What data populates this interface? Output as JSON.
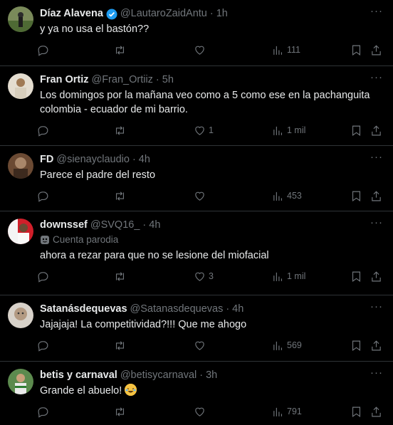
{
  "tweets": [
    {
      "name": "Díaz Alavena",
      "verified": true,
      "handle": "@LautaroZaidAntu",
      "dot": "·",
      "time": "1h",
      "parody": "",
      "text": "y ya no usa el bastón??",
      "likes": "",
      "views": "111",
      "avatar_color": "#6b7a4c"
    },
    {
      "name": "Fran Ortiz",
      "verified": false,
      "handle": "@Fran_Ortiiz",
      "dot": "·",
      "time": "5h",
      "parody": "",
      "text": "Los domingos por la mañana veo como a 5 como ese en la pachanguita colombia - ecuador de mi barrio.",
      "likes": "1",
      "views": "1 mil",
      "avatar_color": "#c9b99a"
    },
    {
      "name": "FD",
      "verified": false,
      "handle": "@sienayclaudio",
      "dot": "·",
      "time": "4h",
      "parody": "",
      "text": "Parece el padre del resto",
      "likes": "",
      "views": "453",
      "avatar_color": "#8a5a3c"
    },
    {
      "name": "downssef",
      "verified": false,
      "handle": "@SVQ16_",
      "dot": "·",
      "time": "4h",
      "parody": "Cuenta parodia",
      "text": "ahora a rezar para que no se lesione del miofacial",
      "likes": "3",
      "views": "1 mil",
      "avatar_color": "#d01f2a"
    },
    {
      "name": "Satanásdequevas",
      "verified": false,
      "handle": "@Satanasdequevas",
      "dot": "·",
      "time": "4h",
      "parody": "",
      "text": "Jajajaja! La competitividad?!!! Que me ahogo",
      "likes": "",
      "views": "569",
      "avatar_color": "#b7a89a"
    },
    {
      "name": "betis y carnaval",
      "verified": false,
      "handle": "@betisycarnaval",
      "dot": "·",
      "time": "3h",
      "parody": "",
      "text": "Grande el abuelo!",
      "likes": "",
      "views": "791",
      "avatar_color": "#3f7a3a"
    }
  ],
  "more_label": "···",
  "colors": {
    "accent": "#1d9bf0",
    "muted": "#71767b",
    "border": "#2f3336"
  }
}
